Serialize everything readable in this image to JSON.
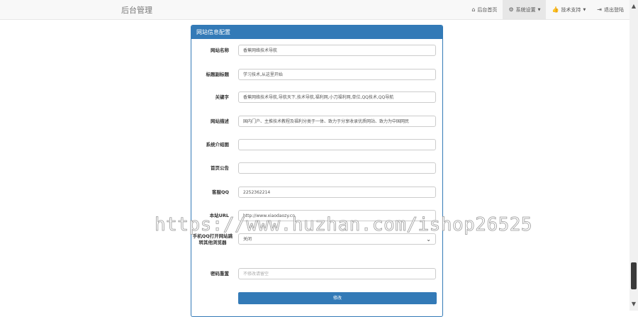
{
  "navbar": {
    "brand": "后台管理",
    "items": [
      {
        "label": "后台首页",
        "icon": "home-icon"
      },
      {
        "label": "系统设置",
        "icon": "gear-icon",
        "caret": true
      },
      {
        "label": "技术支持",
        "icon": "thumbs-up-icon",
        "caret": true
      },
      {
        "label": "退出登陆",
        "icon": "logout-icon"
      }
    ]
  },
  "panel": {
    "title": "网站信息配置",
    "fields": [
      {
        "label": "网站名称",
        "value": "香蕉网络技术导航"
      },
      {
        "label": "标题副标题",
        "value": "学习技术,从这里开始"
      },
      {
        "label": "关键字",
        "value": "香蕉网络技术导航,导航天下,技术导航,福利网,小刀福利网,单位,QQ技术,QQ导航"
      },
      {
        "label": "网站描述",
        "value": "国内门户、主推技术教程及福利分类于一体、致力于分享收录优质网站、致力为中国网民"
      },
      {
        "label": "系统介绍图",
        "value": ""
      },
      {
        "label": "首页公告",
        "value": ""
      },
      {
        "label": "客服QQ",
        "value": "2252362214"
      },
      {
        "label": "本站URL",
        "value": "http://www.xiaodaozy.cn"
      },
      {
        "label": "手机QQ打开网站跳转其他浏览器",
        "value": "关闭"
      },
      {
        "label": "密码重置",
        "placeholder": "不修改请留空"
      }
    ],
    "submit_label": "修改"
  },
  "watermark": "https://www.huzhan.com/ishop26525"
}
